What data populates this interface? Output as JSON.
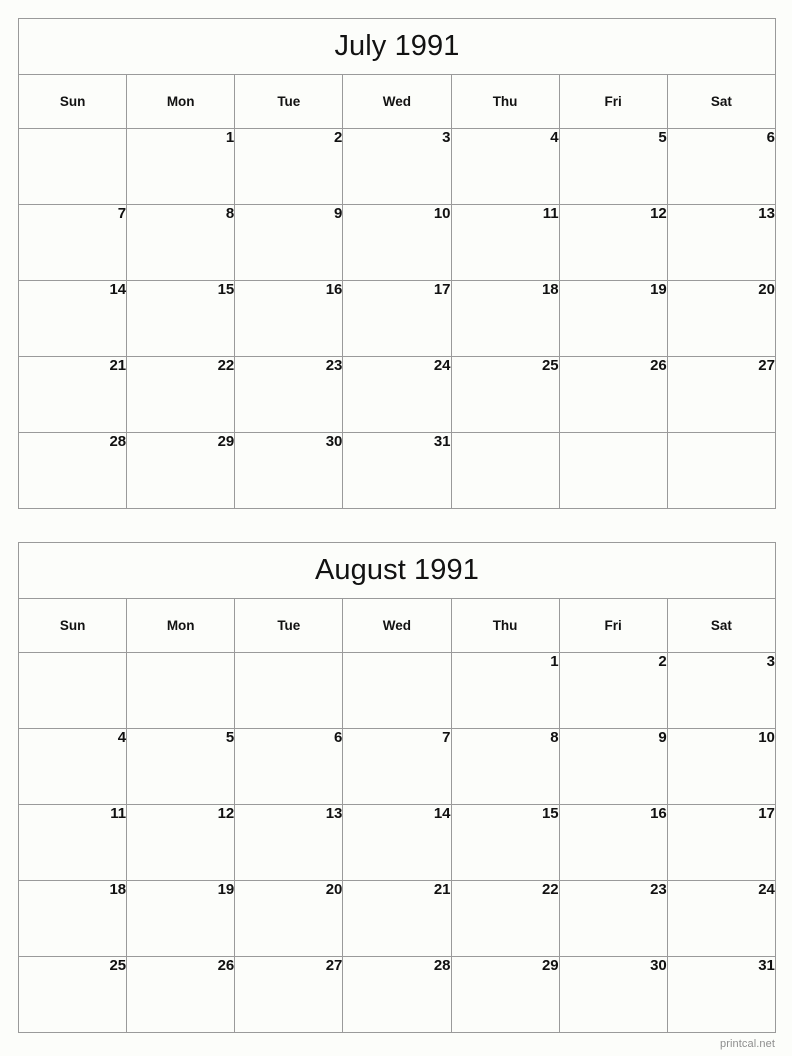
{
  "document": {
    "type": "printable-calendar",
    "footer_text": "printcal.net",
    "border_color": "#9a9a9a",
    "background_color": "#fcfdfa",
    "text_color": "#111111"
  },
  "weekdays": [
    "Sun",
    "Mon",
    "Tue",
    "Wed",
    "Thu",
    "Fri",
    "Sat"
  ],
  "months": [
    {
      "title": "July 1991",
      "name": "July",
      "year": "1991",
      "weeks": [
        [
          "",
          "1",
          "2",
          "3",
          "4",
          "5",
          "6"
        ],
        [
          "7",
          "8",
          "9",
          "10",
          "11",
          "12",
          "13"
        ],
        [
          "14",
          "15",
          "16",
          "17",
          "18",
          "19",
          "20"
        ],
        [
          "21",
          "22",
          "23",
          "24",
          "25",
          "26",
          "27"
        ],
        [
          "28",
          "29",
          "30",
          "31",
          "",
          "",
          ""
        ]
      ]
    },
    {
      "title": "August 1991",
      "name": "August",
      "year": "1991",
      "weeks": [
        [
          "",
          "",
          "",
          "",
          "1",
          "2",
          "3"
        ],
        [
          "4",
          "5",
          "6",
          "7",
          "8",
          "9",
          "10"
        ],
        [
          "11",
          "12",
          "13",
          "14",
          "15",
          "16",
          "17"
        ],
        [
          "18",
          "19",
          "20",
          "21",
          "22",
          "23",
          "24"
        ],
        [
          "25",
          "26",
          "27",
          "28",
          "29",
          "30",
          "31"
        ]
      ]
    }
  ]
}
